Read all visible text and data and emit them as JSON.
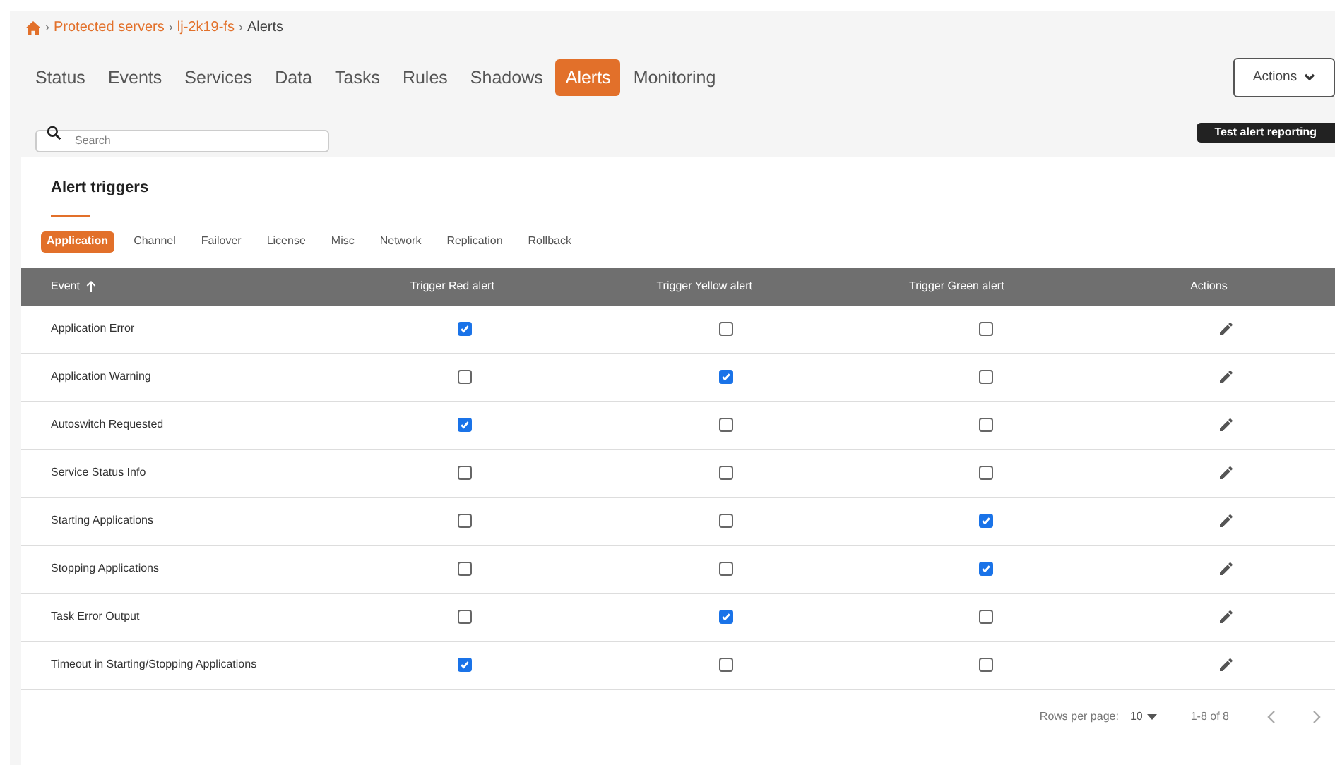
{
  "breadcrumb": [
    {
      "separator": "›",
      "label": "Protected servers",
      "link": true
    },
    {
      "separator": "›",
      "label": "lj-2k19-fs",
      "link": true
    },
    {
      "separator": "›",
      "label": "Alerts",
      "link": false
    }
  ],
  "tabs": [
    {
      "label": "Status",
      "selected": false
    },
    {
      "label": "Events",
      "selected": false
    },
    {
      "label": "Services",
      "selected": false
    },
    {
      "label": "Data",
      "selected": false
    },
    {
      "label": "Tasks",
      "selected": false
    },
    {
      "label": "Rules",
      "selected": false
    },
    {
      "label": "Shadows",
      "selected": false
    },
    {
      "label": "Alerts",
      "selected": true
    },
    {
      "label": "Monitoring",
      "selected": false
    }
  ],
  "actions_button": "Actions",
  "search": {
    "placeholder": "Search"
  },
  "test_button": "Test alert reporting",
  "card_title": "Alert triggers",
  "categories": [
    {
      "label": "Application",
      "selected": true
    },
    {
      "label": "Channel",
      "selected": false
    },
    {
      "label": "Failover",
      "selected": false
    },
    {
      "label": "License",
      "selected": false
    },
    {
      "label": "Misc",
      "selected": false
    },
    {
      "label": "Network",
      "selected": false
    },
    {
      "label": "Replication",
      "selected": false
    },
    {
      "label": "Rollback",
      "selected": false
    }
  ],
  "table": {
    "columns": [
      "Event",
      "Trigger Red alert",
      "Trigger Yellow alert",
      "Trigger Green alert",
      "Actions"
    ],
    "rows": [
      {
        "event": "Application Error",
        "red": true,
        "yellow": false,
        "green": false
      },
      {
        "event": "Application Warning",
        "red": false,
        "yellow": true,
        "green": false
      },
      {
        "event": "Autoswitch Requested",
        "red": true,
        "yellow": false,
        "green": false
      },
      {
        "event": "Service Status Info",
        "red": false,
        "yellow": false,
        "green": false
      },
      {
        "event": "Starting Applications",
        "red": false,
        "yellow": false,
        "green": true
      },
      {
        "event": "Stopping Applications",
        "red": false,
        "yellow": false,
        "green": true
      },
      {
        "event": "Task Error Output",
        "red": false,
        "yellow": true,
        "green": false
      },
      {
        "event": "Timeout in Starting/Stopping Applications",
        "red": true,
        "yellow": false,
        "green": false
      }
    ]
  },
  "pagination": {
    "rows_per_page_label": "Rows per page:",
    "rows_per_page": "10",
    "range": "1-8 of 8"
  }
}
